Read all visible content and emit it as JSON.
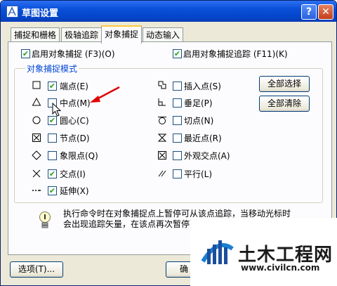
{
  "window": {
    "title": "草图设置",
    "help_label": "?",
    "close_label": "✕"
  },
  "tabs": [
    {
      "label": "捕捉和栅格"
    },
    {
      "label": "极轴追踪"
    },
    {
      "label": "对象捕捉"
    },
    {
      "label": "动态输入"
    }
  ],
  "top_options": {
    "enable_osnap": {
      "label": "启用对象捕捉 (F3)(O)",
      "checked": true
    },
    "enable_tracking": {
      "label": "启用对象捕捉追踪 (F11)(K)",
      "checked": true
    }
  },
  "group_title": "对象捕捉模式",
  "left_modes": [
    {
      "label": "端点(E)",
      "checked": true,
      "icon": "square-icon"
    },
    {
      "label": "中点(M)",
      "checked": false,
      "icon": "triangle-icon"
    },
    {
      "label": "圆心(C)",
      "checked": true,
      "icon": "circle-icon"
    },
    {
      "label": "节点(D)",
      "checked": false,
      "icon": "node-icon"
    },
    {
      "label": "象限点(Q)",
      "checked": false,
      "icon": "diamond-icon"
    },
    {
      "label": "交点(I)",
      "checked": true,
      "icon": "x-icon"
    },
    {
      "label": "延伸(X)",
      "checked": true,
      "icon": "extension-icon"
    }
  ],
  "right_modes": [
    {
      "label": "插入点(S)",
      "checked": false,
      "icon": "insertion-icon"
    },
    {
      "label": "垂足(P)",
      "checked": false,
      "icon": "perpendicular-icon"
    },
    {
      "label": "切点(N)",
      "checked": false,
      "icon": "tangent-icon"
    },
    {
      "label": "最近点(R)",
      "checked": false,
      "icon": "nearest-icon"
    },
    {
      "label": "外观交点(A)",
      "checked": false,
      "icon": "apparent-intersection-icon"
    },
    {
      "label": "平行(L)",
      "checked": false,
      "icon": "parallel-icon"
    }
  ],
  "buttons": {
    "select_all": "全部选择",
    "clear_all": "全部清除",
    "options": "选项(T)...",
    "ok": "确"
  },
  "info_lines": [
    "执行命令时在对象捕捉点上暂停可从该点追踪，当移动光标时",
    "会出现追踪矢量，在该点再次暂停可"
  ],
  "watermark": {
    "brand": "土木工程网",
    "url": "www.civilcn.com"
  },
  "colors": {
    "titlebar": "#0a4fd8",
    "accent_tab": "#ffc83c",
    "check": "#21a121",
    "group_title": "#0046d5"
  }
}
